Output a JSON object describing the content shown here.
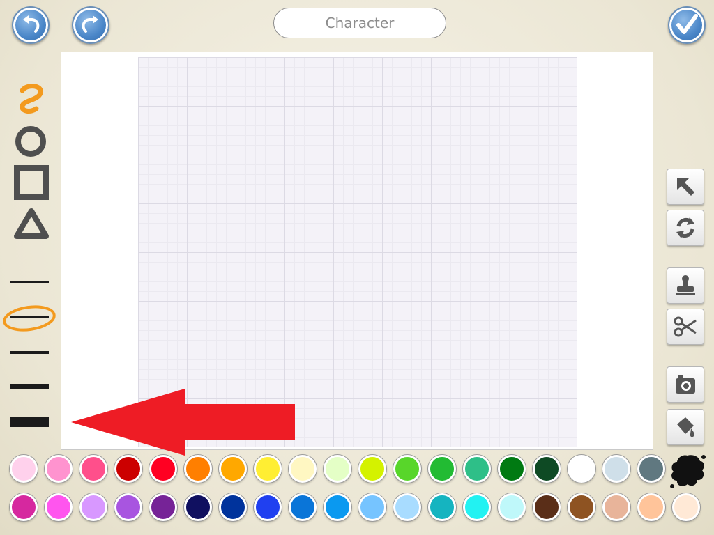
{
  "toolbar": {
    "title": "Character",
    "undo_icon": "undo-arrow-icon",
    "redo_icon": "redo-arrow-icon",
    "done_icon": "checkmark-icon"
  },
  "left_tools": {
    "shapes": [
      "freehand-squiggle-icon",
      "circle-icon",
      "rectangle-icon",
      "triangle-icon"
    ],
    "active_shape": "freehand-squiggle-icon",
    "line_widths": [
      "width-1",
      "width-2",
      "width-3",
      "width-4",
      "width-5"
    ],
    "active_line_width": "width-2"
  },
  "right_tools": [
    "select-arrow-icon",
    "rotate-icon",
    "stamp-icon",
    "scissors-icon",
    "camera-icon",
    "paint-bucket-icon"
  ],
  "colors": {
    "accent_orange": "#f39a1e",
    "arrow_red": "#ee1c25",
    "palette_row1": [
      "#ffd1ec",
      "#ff93cf",
      "#ff4f8b",
      "#cc0000",
      "#ff0022",
      "#ff7f00",
      "#ffa800",
      "#ffee33",
      "#fff7c2",
      "#e4ffc6",
      "#d4f200",
      "#58d62a",
      "#22bb33",
      "#2ebf88",
      "#007a12",
      "#0e4a24",
      "#ffffff",
      "#cfdfe9",
      "#607880"
    ],
    "palette_row2": [
      "#d6289f",
      "#ff55ee",
      "#d898ff",
      "#a855e0",
      "#762397",
      "#101060",
      "#00339c",
      "#2040f0",
      "#0a75d8",
      "#0a99f0",
      "#76c4ff",
      "#a8dcff",
      "#15b4c0",
      "#22f2f2",
      "#bff8fa",
      "#5a2e18",
      "#8e5322",
      "#e8b49a",
      "#ffc49a",
      "#ffe9d6"
    ],
    "ink_icon": "ink-splat-icon"
  }
}
